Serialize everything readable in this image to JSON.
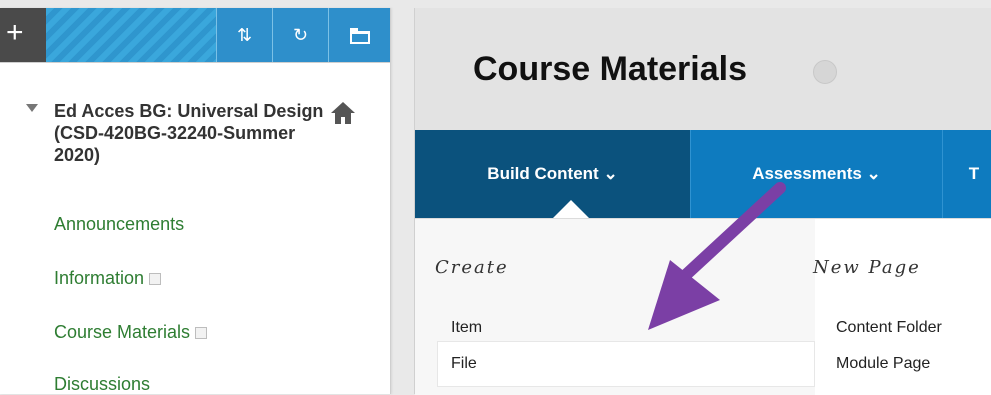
{
  "sidebar": {
    "toolbar": {
      "add_label": "+",
      "sort_icon": "sort-arrows-icon",
      "refresh_icon": "refresh-icon",
      "folder_icon": "folder-icon"
    },
    "course": {
      "title": "Ed Acces BG: Universal Design (CSD-420BG-32240-Summer 2020)",
      "home_icon": "home-icon"
    },
    "items": [
      {
        "label": "Announcements"
      },
      {
        "label": "Information"
      },
      {
        "label": "Course Materials"
      },
      {
        "label": "Discussions"
      }
    ]
  },
  "main": {
    "title": "Course Materials",
    "action_bar": {
      "tabs": [
        {
          "label": "Build Content ⌄"
        },
        {
          "label": "Assessments ⌄"
        },
        {
          "label": "T"
        }
      ]
    },
    "dropdown": {
      "create_heading": "Create",
      "new_page_heading": "New Page",
      "create_items": [
        "Item",
        "File"
      ],
      "new_page_items": [
        "Content Folder",
        "Module Page"
      ]
    }
  },
  "colors": {
    "action_bar": "#0e7bbf",
    "action_active": "#0b527d",
    "link_green": "#2e7d32",
    "arrow_purple": "#7b3fa5"
  }
}
